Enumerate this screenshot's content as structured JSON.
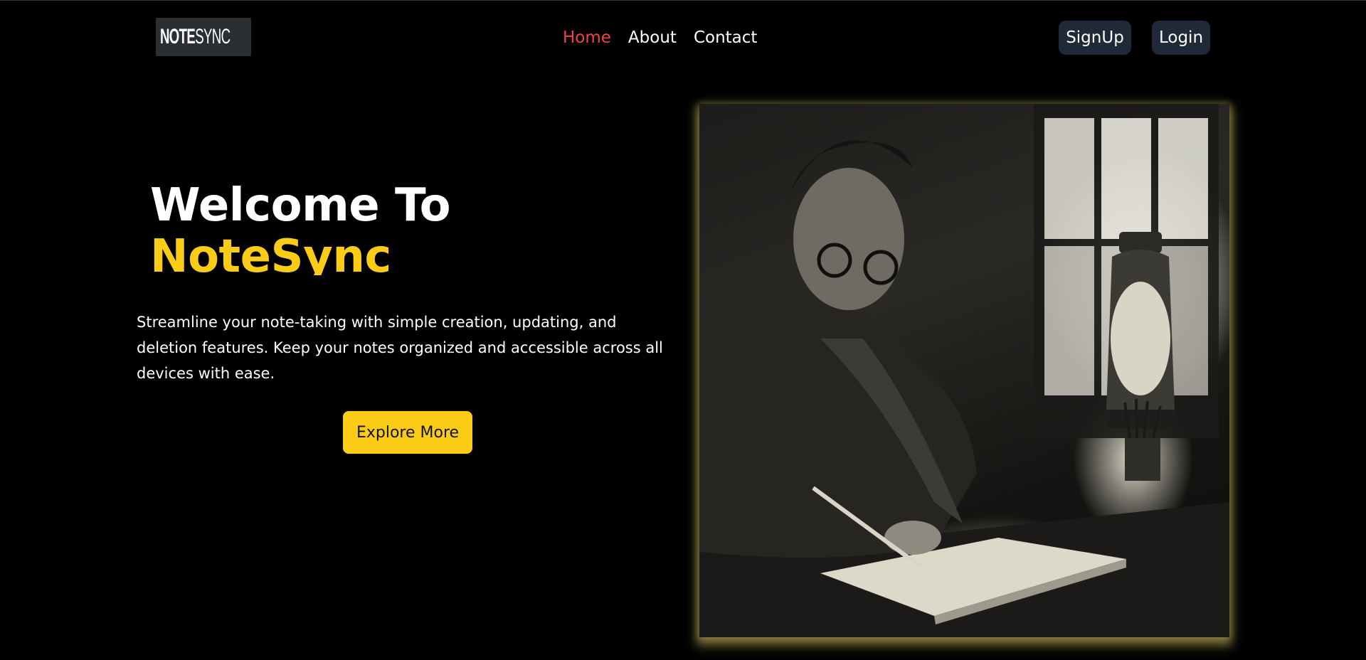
{
  "app": {
    "logo_text_bold": "NOTE",
    "logo_text_thin": "SYNC",
    "logo_icon": "notesync-wave-logo-icon"
  },
  "nav": {
    "items": [
      {
        "label": "Home",
        "active": true
      },
      {
        "label": "About",
        "active": false
      },
      {
        "label": "Contact",
        "active": false
      }
    ],
    "signup_label": "SignUp",
    "login_label": "Login"
  },
  "hero": {
    "title_line1": "Welcome To",
    "title_line2": "NoteSync",
    "description": "Streamline your note-taking with simple creation, updating, and deletion features. Keep your notes organized and accessible across all devices with ease.",
    "cta_label": "Explore More",
    "image_alt": "man-writing-notes-by-lantern-photo"
  },
  "colors": {
    "background": "#000000",
    "accent_yellow": "#facc15",
    "active_nav": "#ef4444",
    "button_dark": "#1f2937",
    "logo_bg": "#2b2f33",
    "logo_icon": "#7ee3c4"
  }
}
